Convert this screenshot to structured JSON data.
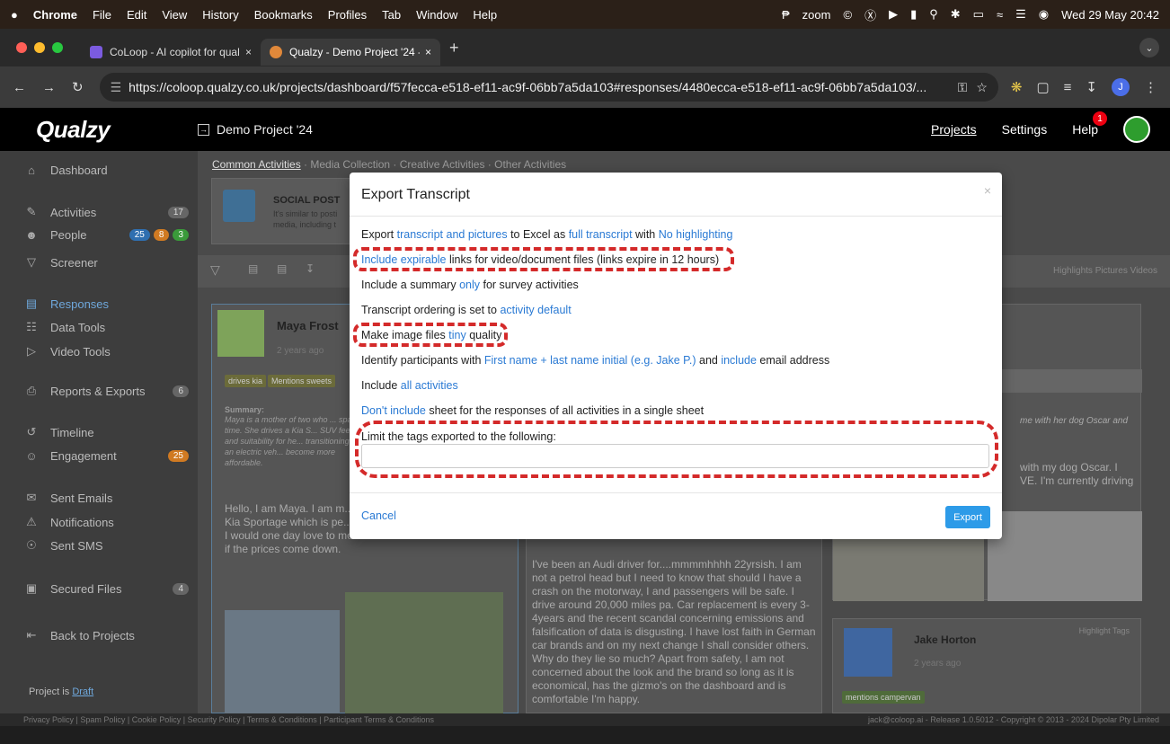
{
  "macbar": {
    "apple": "",
    "menus": [
      "Chrome",
      "File",
      "Edit",
      "View",
      "History",
      "Bookmarks",
      "Profiles",
      "Tab",
      "Window",
      "Help"
    ],
    "zoom": "zoom",
    "datetime": "Wed 29 May  20:42"
  },
  "browser": {
    "tabs": [
      {
        "title": "CoLoop - AI copilot for qualita",
        "close": "×"
      },
      {
        "title": "Qualzy - Demo Project '24 - F",
        "close": "×"
      }
    ],
    "new_tab": "+",
    "url": "https://coloop.qualzy.co.uk/projects/dashboard/f57fecca-e518-ef11-ac9f-06bb7a5da103#responses/4480ecca-e518-ef11-ac9f-06bb7a5da103/...",
    "profile_initial": "J"
  },
  "app": {
    "logo": "Qualzy",
    "project_name": "Demo Project '24",
    "nav": {
      "projects": "Projects",
      "settings": "Settings",
      "help": "Help",
      "help_badge": "1"
    }
  },
  "sidebar": {
    "dashboard": "Dashboard",
    "activities": "Activities",
    "activities_count": "17",
    "people": "People",
    "people_counts": [
      "25",
      "8",
      "3"
    ],
    "screener": "Screener",
    "responses": "Responses",
    "data_tools": "Data Tools",
    "video_tools": "Video Tools",
    "reports": "Reports & Exports",
    "reports_count": "6",
    "timeline": "Timeline",
    "engagement": "Engagement",
    "engagement_count": "25",
    "sent_emails": "Sent Emails",
    "notifications": "Notifications",
    "sent_sms": "Sent SMS",
    "secured_files": "Secured Files",
    "secured_count": "4",
    "back": "Back to Projects",
    "project_is": "Project is",
    "draft": "Draft"
  },
  "main": {
    "crumbs": [
      "Common Activities",
      " · Media Collection · Creative Activities · Other Activities"
    ],
    "activity_title": "SOCIAL POST",
    "activity_desc1": "It's similar to posti",
    "activity_desc2": "media, including t",
    "filter_right": "Highlights  Pictures  Videos",
    "card1": {
      "name": "Maya Frost",
      "meta": "2 years ago",
      "tags": [
        "drives kia",
        "Mentions sweets"
      ],
      "summary_label": "Summary:",
      "summary": "Maya is a mother of two who ... spare time. She drives a Kia S... SUV feel and suitability for he... transitioning to an electric veh... become more affordable.",
      "body": "Hello, I am Maya. I am m... in my spare time I love ga... Kia Sportage which is pe... the SUV type feel of the car. I would one day love to move over to an electric vehicle if the prices come down."
    },
    "card2": {
      "body": "I've been an Audi driver for....mmmmhhhh 22yrsish. I am not a petrol head but I need to know that should I have a crash on the motorway, I and passengers will be safe. I drive around 20,000 miles pa. Car replacement is every 3-4years and the recent scandal concerning emissions and falsification of data is disgusting. I have lost faith in German car brands and on my next change I shall consider others. Why do they lie so much? Apart from safety, I am not concerned about the look and the brand so long as it is economical, has the gizmo's on the dashboard and is comfortable I'm happy."
    },
    "card3": {
      "summary_tail": "me with her dog Oscar and",
      "body_tail1": "with my dog Oscar. I",
      "body_tail2": "VE. I'm currently driving",
      "highlight": "Highlight  Tags",
      "name": "Jake Horton",
      "meta": "2 years ago",
      "tag": "mentions campervan"
    }
  },
  "modal": {
    "title": "Export Transcript",
    "close": "×",
    "line1": {
      "a": "Export ",
      "b": "transcript and pictures",
      "c": " to Excel as ",
      "d": "full transcript",
      "e": " with ",
      "f": "No highlighting"
    },
    "line2": {
      "a": "Include expirable",
      "b": " links for video/document files (links expire in 12 hours)"
    },
    "line3": {
      "a": "Include a summary ",
      "b": "only",
      "c": " for survey activities"
    },
    "line4": {
      "a": "Transcript ordering is set to ",
      "b": "activity default"
    },
    "line5": {
      "a": "Make image files ",
      "b": "tiny",
      "c": " quality"
    },
    "line6": {
      "a": "Identify participants with ",
      "b": "First name + last name initial (e.g. Jake P.)",
      "c": " and ",
      "d": "include",
      "e": " email address"
    },
    "line7": {
      "a": "Include ",
      "b": "all activities"
    },
    "line8": {
      "a": "Don't include",
      "b": " sheet for the responses of all activities in a single sheet"
    },
    "tags_label": "Limit the tags exported to the following:",
    "tags_value": "",
    "cancel": "Cancel",
    "export": "Export"
  },
  "footer": {
    "links": "Privacy Policy  |  Spam Policy  |  Cookie Policy  |  Security Policy  |  Terms & Conditions  |  Participant Terms & Conditions",
    "right": "jack@coloop.ai - Release 1.0.5012 - Copyright © 2013 - 2024 Dipolar Pty Limited"
  },
  "colors": {
    "accent": "#2a7ad4",
    "annotation": "#d42a2a",
    "export_button": "#2d9be8"
  }
}
